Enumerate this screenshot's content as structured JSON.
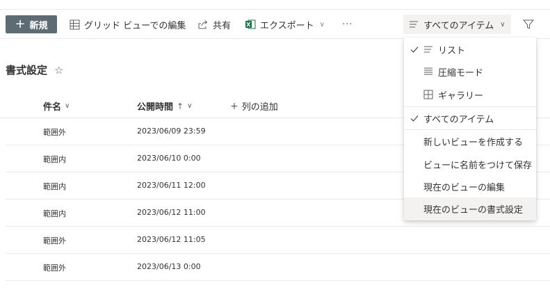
{
  "toolbar": {
    "new_label": "新規",
    "grid_edit_label": "グリッド ビューでの編集",
    "share_label": "共有",
    "export_label": "エクスポート",
    "more_label": "···",
    "view_selector_label": "すべてのアイテム"
  },
  "page": {
    "title": "書式設定"
  },
  "columns": {
    "name": "件名",
    "published": "公開時間",
    "add_column": "列の追加"
  },
  "rows": [
    {
      "name": "範囲外",
      "published": "2023/06/09 23:59"
    },
    {
      "name": "範囲内",
      "published": "2023/06/10 0:00"
    },
    {
      "name": "範囲内",
      "published": "2023/06/11 12:00"
    },
    {
      "name": "範囲内",
      "published": "2023/06/12 11:00"
    },
    {
      "name": "範囲外",
      "published": "2023/06/12 11:05"
    },
    {
      "name": "範囲外",
      "published": "2023/06/13 0:00"
    }
  ],
  "view_menu": {
    "list": "リスト",
    "compact": "圧縮モード",
    "gallery": "ギャラリー",
    "all_items": "すべてのアイテム",
    "create_view": "新しいビューを作成する",
    "save_as": "ビューに名前をつけて保存",
    "edit_view": "現在のビューの編集",
    "format_view": "現在のビューの書式設定"
  },
  "colors": {
    "new_button_bg": "#5c6b74",
    "excel_green": "#107c41",
    "selector_bg": "#f3f2f1",
    "hover_bg": "#f3f2f1",
    "divider": "#edebe9"
  }
}
